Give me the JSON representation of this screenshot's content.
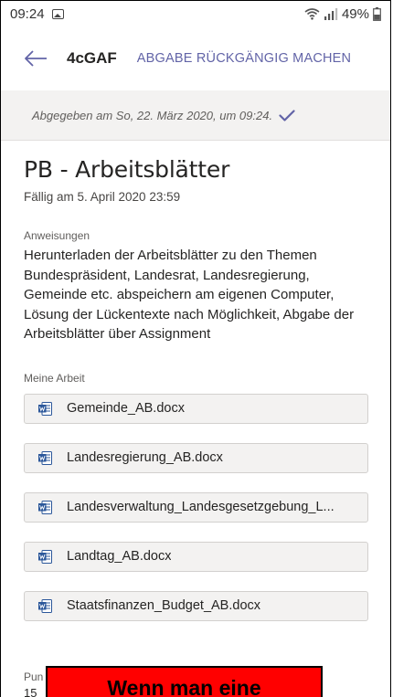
{
  "status_bar": {
    "time": "09:24",
    "battery": "49%"
  },
  "header": {
    "title": "4cGAF",
    "undo_label": "ABGABE RÜCKGÄNGIG MACHEN"
  },
  "submitted": {
    "text": "Abgegeben am So, 22. März 2020, um 09:24."
  },
  "assignment": {
    "title": "PB - Arbeitsblätter",
    "due": "Fällig am 5. April 2020 23:59",
    "instructions_label": "Anweisungen",
    "instructions": "Herunterladen der Arbeitsblätter zu den Themen Bundespräsident, Landesrat, Landesregierung, Gemeinde etc. abspeichern am eigenen Computer, Lösung der Lückentexte nach Möglichkeit, Abgabe der Arbeitsblätter über Assignment"
  },
  "my_work": {
    "label": "Meine Arbeit",
    "files": [
      {
        "name": "Gemeinde_AB.docx"
      },
      {
        "name": "Landesregierung_AB.docx"
      },
      {
        "name": "Landesverwaltung_Landesgesetzgebung_L..."
      },
      {
        "name": "Landtag_AB.docx"
      },
      {
        "name": "Staatsfinanzen_Budget_AB.docx"
      }
    ]
  },
  "points": {
    "label": "Pun",
    "value": "15"
  },
  "overlay": {
    "text": "Wenn man eine"
  },
  "icons": {
    "back": "arrow-left-icon",
    "check": "checkmark-icon",
    "file": "word-document-icon",
    "wifi": "wifi-icon",
    "signal": "signal-icon",
    "battery": "battery-icon",
    "gallery": "image-icon"
  },
  "colors": {
    "accent": "#6264a7",
    "banner_bg": "#f3f2f1",
    "word_blue": "#2b579a",
    "overlay_red": "#ff0000"
  }
}
